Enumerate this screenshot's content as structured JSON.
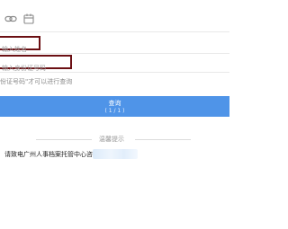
{
  "toolbar": {
    "icons": [
      "link-icon",
      "calendar-icon"
    ]
  },
  "form": {
    "name_placeholder": "输入姓名",
    "id_placeholder": "输入身份证号码",
    "hint": "份证号码\"才可以进行查询"
  },
  "query_button": {
    "label": "查询",
    "sub_label": "( 1 / 1 )"
  },
  "notice": {
    "title": "温馨提示",
    "contact_text": "请致电广州人事档案托管中心咨询: 0"
  },
  "colors": {
    "button": "#4f94e8",
    "field_border": "#6b0f13"
  }
}
